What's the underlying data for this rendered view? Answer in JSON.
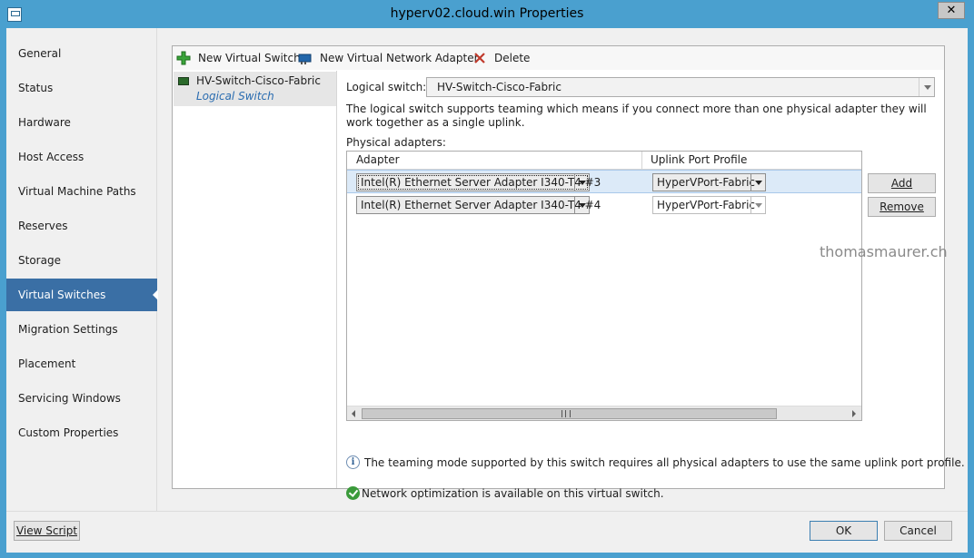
{
  "window": {
    "title": "hyperv02.cloud.win Properties",
    "close_glyph": "✕"
  },
  "nav": {
    "items": [
      {
        "label": "General"
      },
      {
        "label": "Status"
      },
      {
        "label": "Hardware"
      },
      {
        "label": "Host Access"
      },
      {
        "label": "Virtual Machine Paths"
      },
      {
        "label": "Reserves"
      },
      {
        "label": "Storage"
      },
      {
        "label": "Virtual Switches",
        "active": true
      },
      {
        "label": "Migration Settings"
      },
      {
        "label": "Placement"
      },
      {
        "label": "Servicing Windows"
      },
      {
        "label": "Custom Properties"
      }
    ]
  },
  "toolbar": {
    "new_virtual_switch": "New Virtual Switch",
    "new_virtual_network_adapter": "New Virtual Network Adapter",
    "delete": "Delete"
  },
  "switches": [
    {
      "name": "HV-Switch-Cisco-Fabric",
      "type": "Logical Switch"
    }
  ],
  "detail": {
    "logical_switch_label": "Logical switch:",
    "logical_switch_value": "HV-Switch-Cisco-Fabric",
    "description": "The logical switch supports teaming which means if you connect more than one physical adapter they will work together as a single uplink.",
    "physical_adapters_label": "Physical adapters:",
    "columns": {
      "adapter": "Adapter",
      "uplink_port_profile": "Uplink Port Profile"
    },
    "rows": [
      {
        "adapter": "Intel(R) Ethernet Server Adapter I340-T4 #3",
        "profile": "HyperVPort-Fabric"
      },
      {
        "adapter": "Intel(R) Ethernet Server Adapter I340-T4 #4",
        "profile": "HyperVPort-Fabric"
      }
    ],
    "add_button": "Add",
    "remove_button": "Remove",
    "info_glyph": "i",
    "info_text": "The teaming mode supported by this switch requires all physical adapters to use the same uplink port profile.",
    "optimization_text": "Network optimization is available on this virtual switch."
  },
  "watermark": "thomasmaurer.ch",
  "footer": {
    "view_script": "View Script",
    "ok": "OK",
    "cancel": "Cancel"
  }
}
